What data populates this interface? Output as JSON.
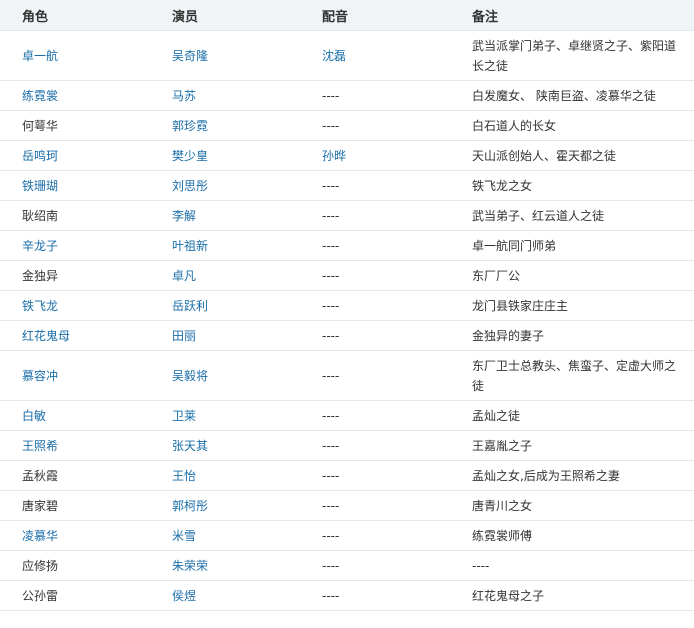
{
  "headers": [
    "角色",
    "演员",
    "配音",
    "备注"
  ],
  "rows": [
    {
      "role": "卓一航",
      "role_link": true,
      "actor": "吴奇隆",
      "actor_link": true,
      "voice": "沈磊",
      "voice_link": true,
      "note": "武当派掌门弟子、卓继贤之子、紫阳道长之徒",
      "tall": true
    },
    {
      "role": "练霓裳",
      "role_link": true,
      "actor": "马苏",
      "actor_link": true,
      "voice": "----",
      "voice_link": false,
      "note": "白发魔女、 陕南巨盗、凌慕华之徒",
      "tall": false
    },
    {
      "role": "何萼华",
      "role_link": false,
      "actor": "郭珍霓",
      "actor_link": true,
      "voice": "----",
      "voice_link": false,
      "note": "白石道人的长女",
      "tall": false
    },
    {
      "role": "岳鸣珂",
      "role_link": true,
      "actor": "樊少皇",
      "actor_link": true,
      "voice": "孙晔",
      "voice_link": true,
      "note": "天山派创始人、霍天都之徒",
      "tall": false
    },
    {
      "role": "铁珊瑚",
      "role_link": true,
      "actor": "刘思彤",
      "actor_link": true,
      "voice": "----",
      "voice_link": false,
      "note": "铁飞龙之女",
      "tall": false
    },
    {
      "role": "耿绍南",
      "role_link": false,
      "actor": "李解",
      "actor_link": true,
      "voice": "----",
      "voice_link": false,
      "note": "武当弟子、红云道人之徒",
      "tall": false
    },
    {
      "role": "辛龙子",
      "role_link": true,
      "actor": "叶祖新",
      "actor_link": true,
      "voice": "----",
      "voice_link": false,
      "note": "卓一航同门师弟",
      "tall": false
    },
    {
      "role": "金独异",
      "role_link": false,
      "actor": "卓凡",
      "actor_link": true,
      "voice": "----",
      "voice_link": false,
      "note": "东厂厂公",
      "tall": false
    },
    {
      "role": "铁飞龙",
      "role_link": true,
      "actor": "岳跃利",
      "actor_link": true,
      "voice": "----",
      "voice_link": false,
      "note": "龙门县铁家庄庄主",
      "tall": false
    },
    {
      "role": "红花鬼母",
      "role_link": true,
      "actor": "田丽",
      "actor_link": true,
      "voice": "----",
      "voice_link": false,
      "note": "金独异的妻子",
      "tall": false
    },
    {
      "role": "慕容冲",
      "role_link": true,
      "actor": "吴毅将",
      "actor_link": true,
      "voice": "----",
      "voice_link": false,
      "note": "东厂卫士总教头、焦蛮子、定虚大师之徒",
      "tall": true
    },
    {
      "role": "白敏",
      "role_link": true,
      "actor": "卫莱",
      "actor_link": true,
      "voice": "----",
      "voice_link": false,
      "note": "孟灿之徒",
      "tall": false
    },
    {
      "role": "王照希",
      "role_link": true,
      "actor": "张天其",
      "actor_link": true,
      "voice": "----",
      "voice_link": false,
      "note": "王嘉胤之子",
      "tall": false
    },
    {
      "role": "孟秋霞",
      "role_link": false,
      "actor": "王怡",
      "actor_link": true,
      "voice": "----",
      "voice_link": false,
      "note": "孟灿之女,后成为王照希之妻",
      "tall": false
    },
    {
      "role": "唐家碧",
      "role_link": false,
      "actor": "郭柯彤",
      "actor_link": true,
      "voice": "----",
      "voice_link": false,
      "note": "唐青川之女",
      "tall": false
    },
    {
      "role": "凌慕华",
      "role_link": true,
      "actor": "米雪",
      "actor_link": true,
      "voice": "----",
      "voice_link": false,
      "note": "练霓裳师傅",
      "tall": false
    },
    {
      "role": "应修扬",
      "role_link": false,
      "actor": "朱荣荣",
      "actor_link": true,
      "voice": "----",
      "voice_link": false,
      "note": "----",
      "tall": false
    },
    {
      "role": "公孙雷",
      "role_link": false,
      "actor": "侯煜",
      "actor_link": true,
      "voice": "----",
      "voice_link": false,
      "note": "红花鬼母之子",
      "tall": false
    }
  ]
}
